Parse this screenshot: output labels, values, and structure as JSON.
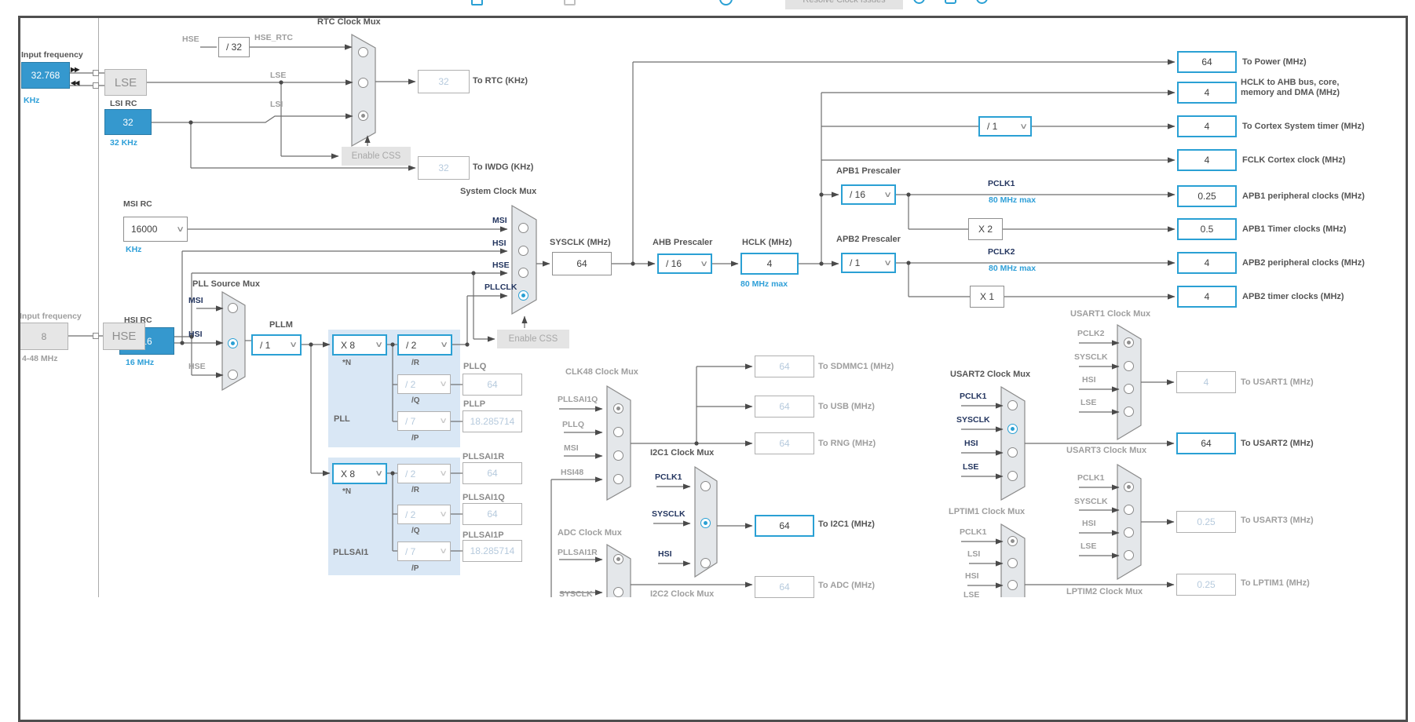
{
  "toolbar": {
    "resolve_button": "Resolve Clock Issues"
  },
  "icons": {
    "chevron": "∨",
    "transfer_out": "▶▶",
    "transfer_in": "◀◀"
  },
  "colors": {
    "accent": "#2aa0d4",
    "source_fill": "#3598ce",
    "note_blue": "#2e9fd8"
  },
  "left": {
    "lse_freq": {
      "label": "Input frequency",
      "value": "32.768",
      "unit": "KHz"
    },
    "lse": "LSE",
    "lsi": {
      "label": "LSI RC",
      "value": "32",
      "unit": "32 KHz"
    },
    "msi": {
      "label": "MSI RC",
      "value": "16000",
      "unit": "KHz"
    },
    "hsi": {
      "label": "HSI RC",
      "value": "16",
      "unit": "16 MHz"
    },
    "hse_freq": {
      "label": "Input frequency",
      "value": "8",
      "unit": "4-48 MHz"
    },
    "hse": "HSE"
  },
  "rtc": {
    "title": "RTC Clock Mux",
    "hse": "HSE",
    "div32": "/ 32",
    "hse_rtc": "HSE_RTC",
    "lse": "LSE",
    "lsi": "LSI",
    "to_rtc_value": "32",
    "to_rtc_label": "To RTC (KHz)",
    "to_iwdg_value": "32",
    "to_iwdg_label": "To IWDG (KHz)",
    "enable_css": "Enable CSS"
  },
  "sysmux": {
    "title": "System Clock Mux",
    "in0": "MSI",
    "in1": "HSI",
    "in2": "HSE",
    "in3": "PLLCLK",
    "enable_css": "Enable CSS"
  },
  "sysclk": {
    "label": "SYSCLK (MHz)",
    "value": "64"
  },
  "ahb": {
    "label": "AHB Prescaler",
    "value": "/ 16"
  },
  "hclk": {
    "label": "HCLK (MHz)",
    "value": "4",
    "note": "80 MHz max"
  },
  "apb1": {
    "label": "APB1 Prescaler",
    "value": "/ 16",
    "pclk": "PCLK1",
    "note": "80 MHz max",
    "mult": "X 2"
  },
  "apb2": {
    "label": "APB2 Prescaler",
    "value": "/ 1",
    "pclk": "PCLK2",
    "note": "80 MHz max",
    "mult": "X 1"
  },
  "cortex_div": "/ 1",
  "outputs": {
    "power": {
      "value": "64",
      "label": "To Power (MHz)"
    },
    "ahb_bus": {
      "value": "4",
      "label": "HCLK to AHB bus, core,",
      "label2": "memory and DMA (MHz)"
    },
    "cortex_timer": {
      "value": "4",
      "label": "To Cortex System timer (MHz)"
    },
    "fclk": {
      "value": "4",
      "label": "FCLK Cortex clock (MHz)"
    },
    "apb1_periph": {
      "value": "0.25",
      "label": "APB1 peripheral clocks (MHz)"
    },
    "apb1_timer": {
      "value": "0.5",
      "label": "APB1 Timer clocks (MHz)"
    },
    "apb2_periph": {
      "value": "4",
      "label": "APB2 peripheral clocks (MHz)"
    },
    "apb2_timer": {
      "value": "4",
      "label": "APB2 timer clocks (MHz)"
    },
    "sdmmc": {
      "value": "64",
      "label": "To SDMMC1 (MHz)"
    },
    "usb": {
      "value": "64",
      "label": "To USB (MHz)"
    },
    "rng": {
      "value": "64",
      "label": "To RNG (MHz)"
    },
    "i2c1": {
      "value": "64",
      "label": "To I2C1 (MHz)"
    },
    "adc": {
      "value": "64",
      "label": "To ADC (MHz)"
    },
    "usart1": {
      "value": "4",
      "label": "To USART1 (MHz)"
    },
    "usart2": {
      "value": "64",
      "label": "To USART2 (MHz)"
    },
    "usart3": {
      "value": "0.25",
      "label": "To USART3 (MHz)"
    },
    "lptim1": {
      "value": "0.25",
      "label": "To LPTIM1 (MHz)"
    }
  },
  "pllmux": {
    "title": "PLL Source Mux",
    "in0": "MSI",
    "in1": "HSI",
    "in2": "HSE",
    "pllm_label": "PLLM",
    "pllm": "/ 1"
  },
  "pll": {
    "name": "PLL",
    "n": "X 8",
    "n_label": "*N",
    "r": "/ 2",
    "r_label": "/R",
    "q": "/ 2",
    "q_label": "/Q",
    "p": "/ 7",
    "p_label": "/P",
    "q_out_label": "PLLQ",
    "q_out": "64",
    "p_out_label": "PLLP",
    "p_out": "18.285714"
  },
  "pllsai1": {
    "name": "PLLSAI1",
    "n": "X 8",
    "n_label": "*N",
    "r": "/ 2",
    "r_label": "/R",
    "q": "/ 2",
    "q_label": "/Q",
    "p": "/ 7",
    "p_label": "/P",
    "r_out_label": "PLLSAI1R",
    "r_out": "64",
    "q_out_label": "PLLSAI1Q",
    "q_out": "64",
    "p_out_label": "PLLSAI1P",
    "p_out": "18.285714"
  },
  "clk48": {
    "title": "CLK48 Clock Mux",
    "in0": "PLLSAI1Q",
    "in1": "PLLQ",
    "in2": "MSI",
    "in3": "HSI48"
  },
  "i2c1mux": {
    "title": "I2C1 Clock Mux",
    "in0": "PCLK1",
    "in1": "SYSCLK",
    "in2": "HSI"
  },
  "adcmux": {
    "title": "ADC Clock Mux",
    "in0": "PLLSAI1R",
    "in1": "SYSCLK"
  },
  "i2c2mux": {
    "title": "I2C2 Clock Mux"
  },
  "usart1mux": {
    "title": "USART1 Clock Mux",
    "in0": "PCLK2",
    "in1": "SYSCLK",
    "in2": "HSI",
    "in3": "LSE"
  },
  "usart2mux": {
    "title": "USART2 Clock Mux",
    "in0": "PCLK1",
    "in1": "SYSCLK",
    "in2": "HSI",
    "in3": "LSE"
  },
  "usart3mux": {
    "title": "USART3 Clock Mux",
    "in0": "PCLK1",
    "in1": "SYSCLK",
    "in2": "HSI",
    "in3": "LSE"
  },
  "lptim1mux": {
    "title": "LPTIM1 Clock Mux",
    "in0": "PCLK1",
    "in1": "LSI",
    "in2": "HSI",
    "in3": "LSE"
  },
  "lptim2mux": {
    "title": "LPTIM2 Clock Mux"
  }
}
